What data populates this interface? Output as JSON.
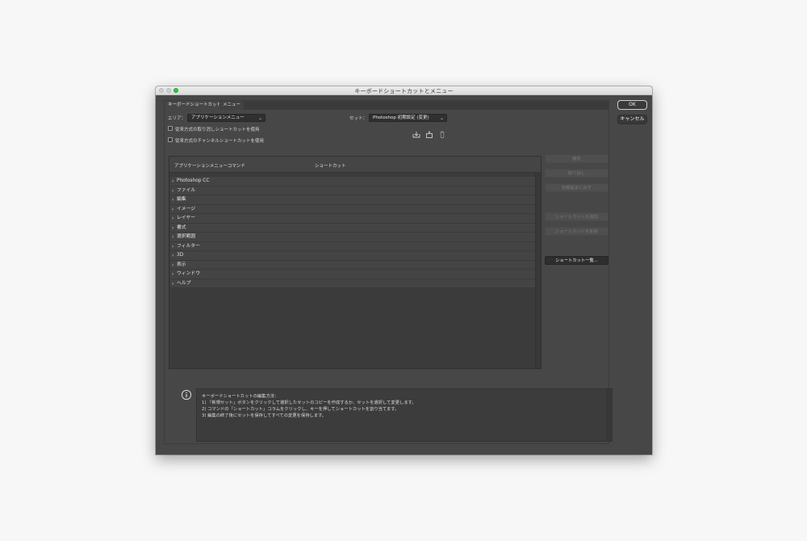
{
  "window": {
    "title": "キーボードショートカットとメニュー"
  },
  "tabs": [
    {
      "label": "キーボードショートカット"
    },
    {
      "label": "メニュー"
    }
  ],
  "area": {
    "label": "エリア：",
    "value": "アプリケーションメニュー"
  },
  "set": {
    "label": "セット：",
    "value": "Photoshop 初期設定 (変更)"
  },
  "checkboxes": [
    {
      "label": "従来方式の取り消しショートカットを使用",
      "checked": false
    },
    {
      "label": "従来方式のチャンネルショートカットを使用",
      "checked": false
    }
  ],
  "set_icons": [
    "save-set-icon",
    "new-set-icon",
    "delete-set-icon"
  ],
  "table": {
    "columns": [
      "アプリケーションメニューコマンド",
      "ショートカット"
    ],
    "rows": [
      {
        "label": "Photoshop CC"
      },
      {
        "label": "ファイル"
      },
      {
        "label": "編集"
      },
      {
        "label": "イメージ"
      },
      {
        "label": "レイヤー"
      },
      {
        "label": "書式"
      },
      {
        "label": "選択範囲"
      },
      {
        "label": "フィルター"
      },
      {
        "label": "3D"
      },
      {
        "label": "表示"
      },
      {
        "label": "ウィンドウ"
      },
      {
        "label": "ヘルプ"
      }
    ]
  },
  "side_buttons": {
    "accept": "確定",
    "undo": "取り消し",
    "use_default": "初期設定に戻す",
    "add_shortcut": "ショートカットを追加",
    "delete_shortcut": "ショートカットを削除",
    "summarize": "ショートカット一覧..."
  },
  "info": {
    "lines": [
      "キーボードショートカットの編集方法：",
      "1) 「新規セット」ボタンをクリックして選択したセットのコピーを作成するか、セットを選択して変更します。",
      "2) コマンドの「ショートカット」コラムをクリックし、キーを押してショートカットを割り当てます。",
      "3) 編集の終了後にセットを保存してすべての変更を保持します。"
    ]
  },
  "dialog_buttons": {
    "ok": "OK",
    "cancel": "キャンセル"
  },
  "colors": {
    "window_bg": "#474747",
    "panel_bg": "#3b3b3b",
    "titlebar": "#e4e4e4",
    "maximize_dot": "#2ec840"
  }
}
